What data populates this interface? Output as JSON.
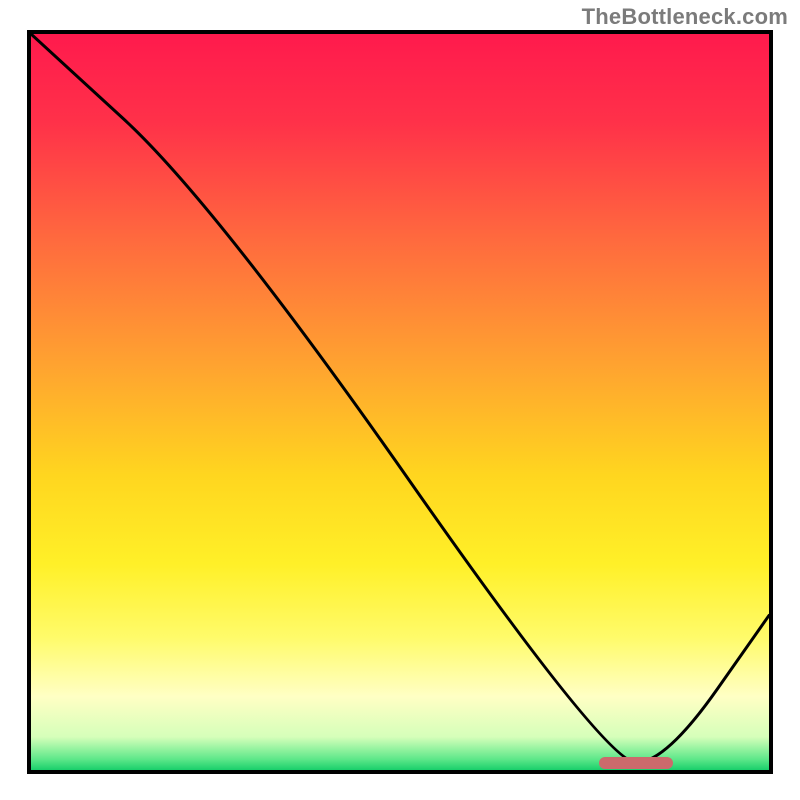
{
  "watermark": "TheBottleneck.com",
  "colors": {
    "border": "#000000",
    "curve": "#000000",
    "marker": "#cc6a6c",
    "gradient_stops": [
      {
        "offset": 0.0,
        "color": "#ff1a4d"
      },
      {
        "offset": 0.12,
        "color": "#ff3149"
      },
      {
        "offset": 0.28,
        "color": "#ff6a3e"
      },
      {
        "offset": 0.45,
        "color": "#ffa330"
      },
      {
        "offset": 0.6,
        "color": "#ffd61f"
      },
      {
        "offset": 0.72,
        "color": "#fff028"
      },
      {
        "offset": 0.82,
        "color": "#fffb6a"
      },
      {
        "offset": 0.9,
        "color": "#ffffc4"
      },
      {
        "offset": 0.955,
        "color": "#d6ffba"
      },
      {
        "offset": 0.985,
        "color": "#5fe88a"
      },
      {
        "offset": 1.0,
        "color": "#19cf6b"
      }
    ]
  },
  "chart_data": {
    "type": "line",
    "title": "",
    "xlabel": "",
    "ylabel": "",
    "xlim": [
      0,
      100
    ],
    "ylim": [
      0,
      100
    ],
    "grid": false,
    "legend": false,
    "series": [
      {
        "name": "bottleneck-curve",
        "x": [
          0,
          25,
          78,
          86,
          100
        ],
        "values": [
          100,
          77,
          1,
          1,
          21
        ]
      }
    ],
    "annotations": [
      {
        "name": "optimal-marker",
        "x_start": 77,
        "x_end": 87,
        "y": 1
      }
    ]
  }
}
